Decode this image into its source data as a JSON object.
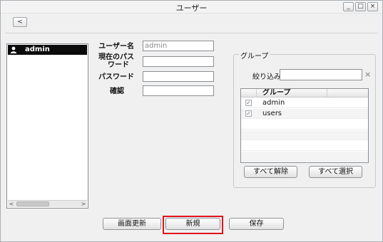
{
  "window": {
    "title": "ユーザー",
    "controls": {
      "minimize": "_",
      "maximize": "□",
      "close": "×"
    },
    "back_icon": "<"
  },
  "user_list": {
    "items": [
      {
        "label": "admin",
        "icon": "user-icon",
        "selected": true
      }
    ],
    "scroll_left": "<",
    "scroll_right": ">"
  },
  "form": {
    "username_label": "ユーザー名",
    "username_value": "admin",
    "current_password_label_1": "現在のパス",
    "current_password_label_2": "ワード",
    "current_password_value": "",
    "password_label": "パスワード",
    "password_value": "",
    "confirm_label": "確認",
    "confirm_value": ""
  },
  "group_panel": {
    "legend": "グループ",
    "filter_label": "絞り込み",
    "filter_value": "",
    "clear_icon": "×",
    "table": {
      "header": "グループ",
      "rows": [
        {
          "name": "admin",
          "checked": true
        },
        {
          "name": "users",
          "checked": true
        }
      ]
    },
    "deselect_all": "すべて解除",
    "select_all": "すべて選択"
  },
  "footer": {
    "refresh": "画面更新",
    "new": "新規",
    "save": "保存"
  },
  "colors": {
    "highlight": "#e1131b",
    "selection_bg": "#0b0b0b"
  }
}
